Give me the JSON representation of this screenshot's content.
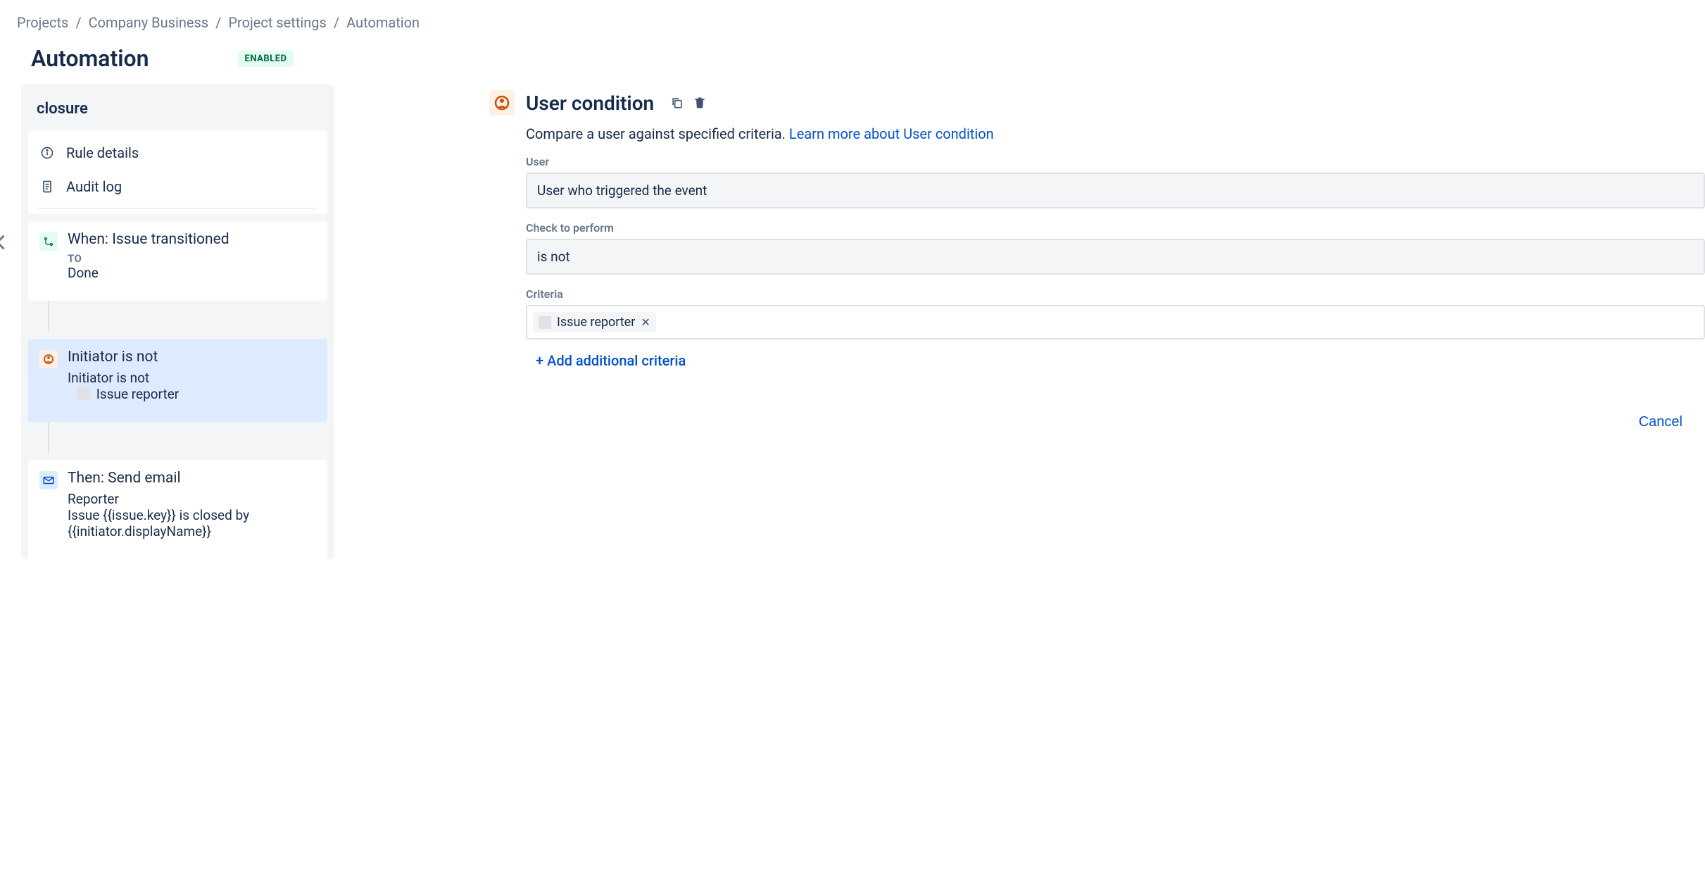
{
  "breadcrumbs": {
    "items": [
      "Projects",
      "Company Business",
      "Project settings",
      "Automation"
    ]
  },
  "header": {
    "title": "Automation",
    "status": "ENABLED"
  },
  "rule": {
    "name": "closure",
    "nav": {
      "details": "Rule details",
      "audit": "Audit log"
    },
    "steps": {
      "trigger": {
        "title": "When: Issue transitioned",
        "sub_label": "TO",
        "sub_value": "Done"
      },
      "condition": {
        "title": "Initiator is not",
        "detail_prefix": "Initiator is not",
        "detail_value": "Issue reporter"
      },
      "action": {
        "title": "Then: Send email",
        "line1": "Reporter",
        "line2": "Issue {{issue.key}} is closed by {{initiator.displayName}}"
      }
    }
  },
  "detail": {
    "title": "User condition",
    "description": "Compare a user against specified criteria. ",
    "learn_more": "Learn more about User condition",
    "fields": {
      "user": {
        "label": "User",
        "value": "User who triggered the event"
      },
      "check": {
        "label": "Check to perform",
        "value": "is not"
      },
      "criteria": {
        "label": "Criteria",
        "tags": [
          "Issue reporter"
        ]
      }
    },
    "add_criteria": "+ Add additional criteria",
    "cancel": "Cancel"
  },
  "colors": {
    "link": "#0052CC",
    "text": "#172B4D",
    "subtle": "#6B778C"
  }
}
